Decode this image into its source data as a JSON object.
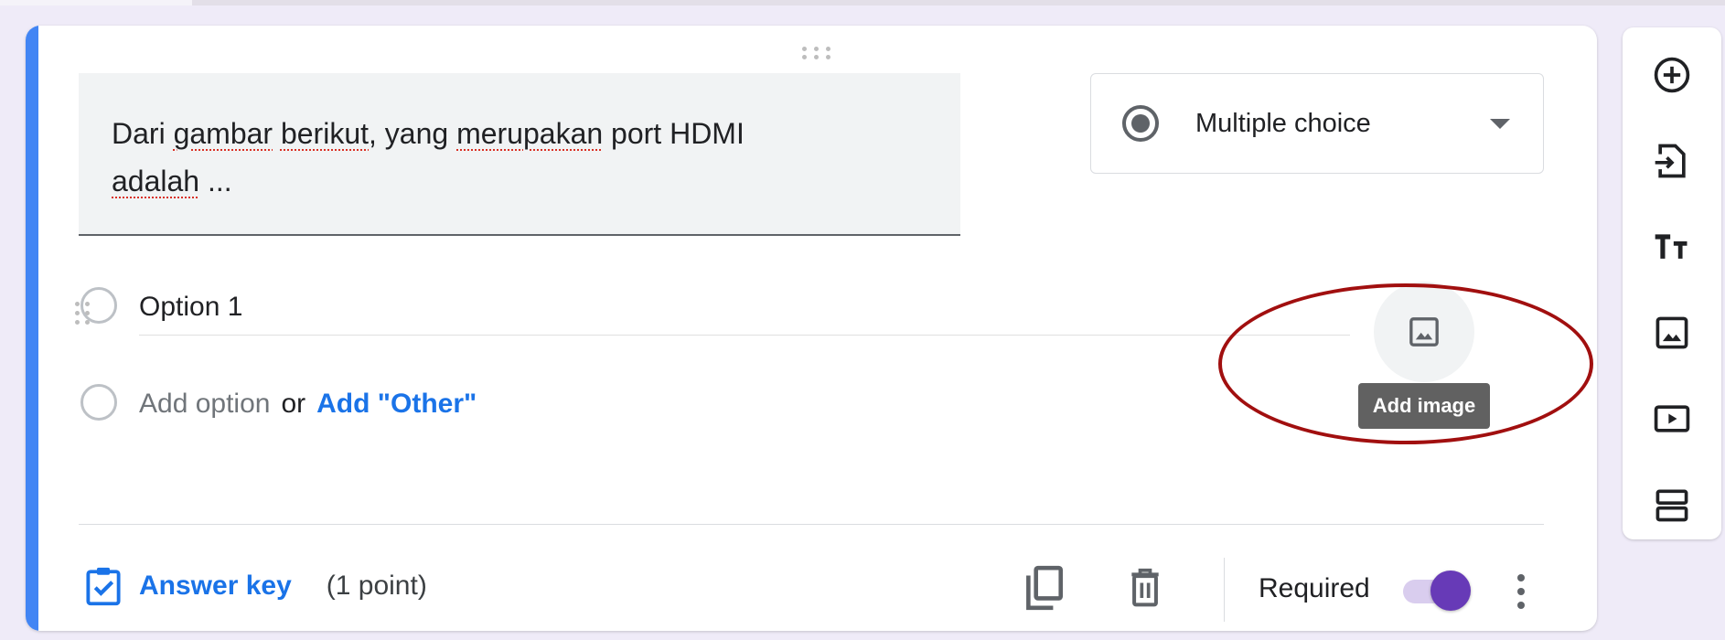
{
  "question": {
    "text_parts": [
      "Dari ",
      "gambar",
      " ",
      "berikut",
      ", yang ",
      "merupakan",
      " port HDMI ",
      "adalah",
      " ..."
    ]
  },
  "question_type": {
    "selected": "Multiple choice",
    "icon": "radio-button-checked-icon"
  },
  "options": [
    {
      "label": "Option 1"
    }
  ],
  "add_option": {
    "label": "Add option",
    "or_text": "or",
    "other_label": "Add \"Other\""
  },
  "add_image": {
    "tooltip": "Add image",
    "icon": "image-icon"
  },
  "footer": {
    "answer_key_label": "Answer key",
    "points": "(1 point)",
    "required_label": "Required",
    "required_on": true
  },
  "side_toolbar": {
    "tools": [
      "add-question-icon",
      "import-questions-icon",
      "add-title-icon",
      "add-image-icon",
      "add-video-icon",
      "add-section-icon"
    ]
  },
  "colors": {
    "accent": "#4285f4",
    "link": "#1a73e8",
    "toggle": "#673ab7",
    "highlight": "#a10f0f",
    "background": "#efebf8"
  }
}
